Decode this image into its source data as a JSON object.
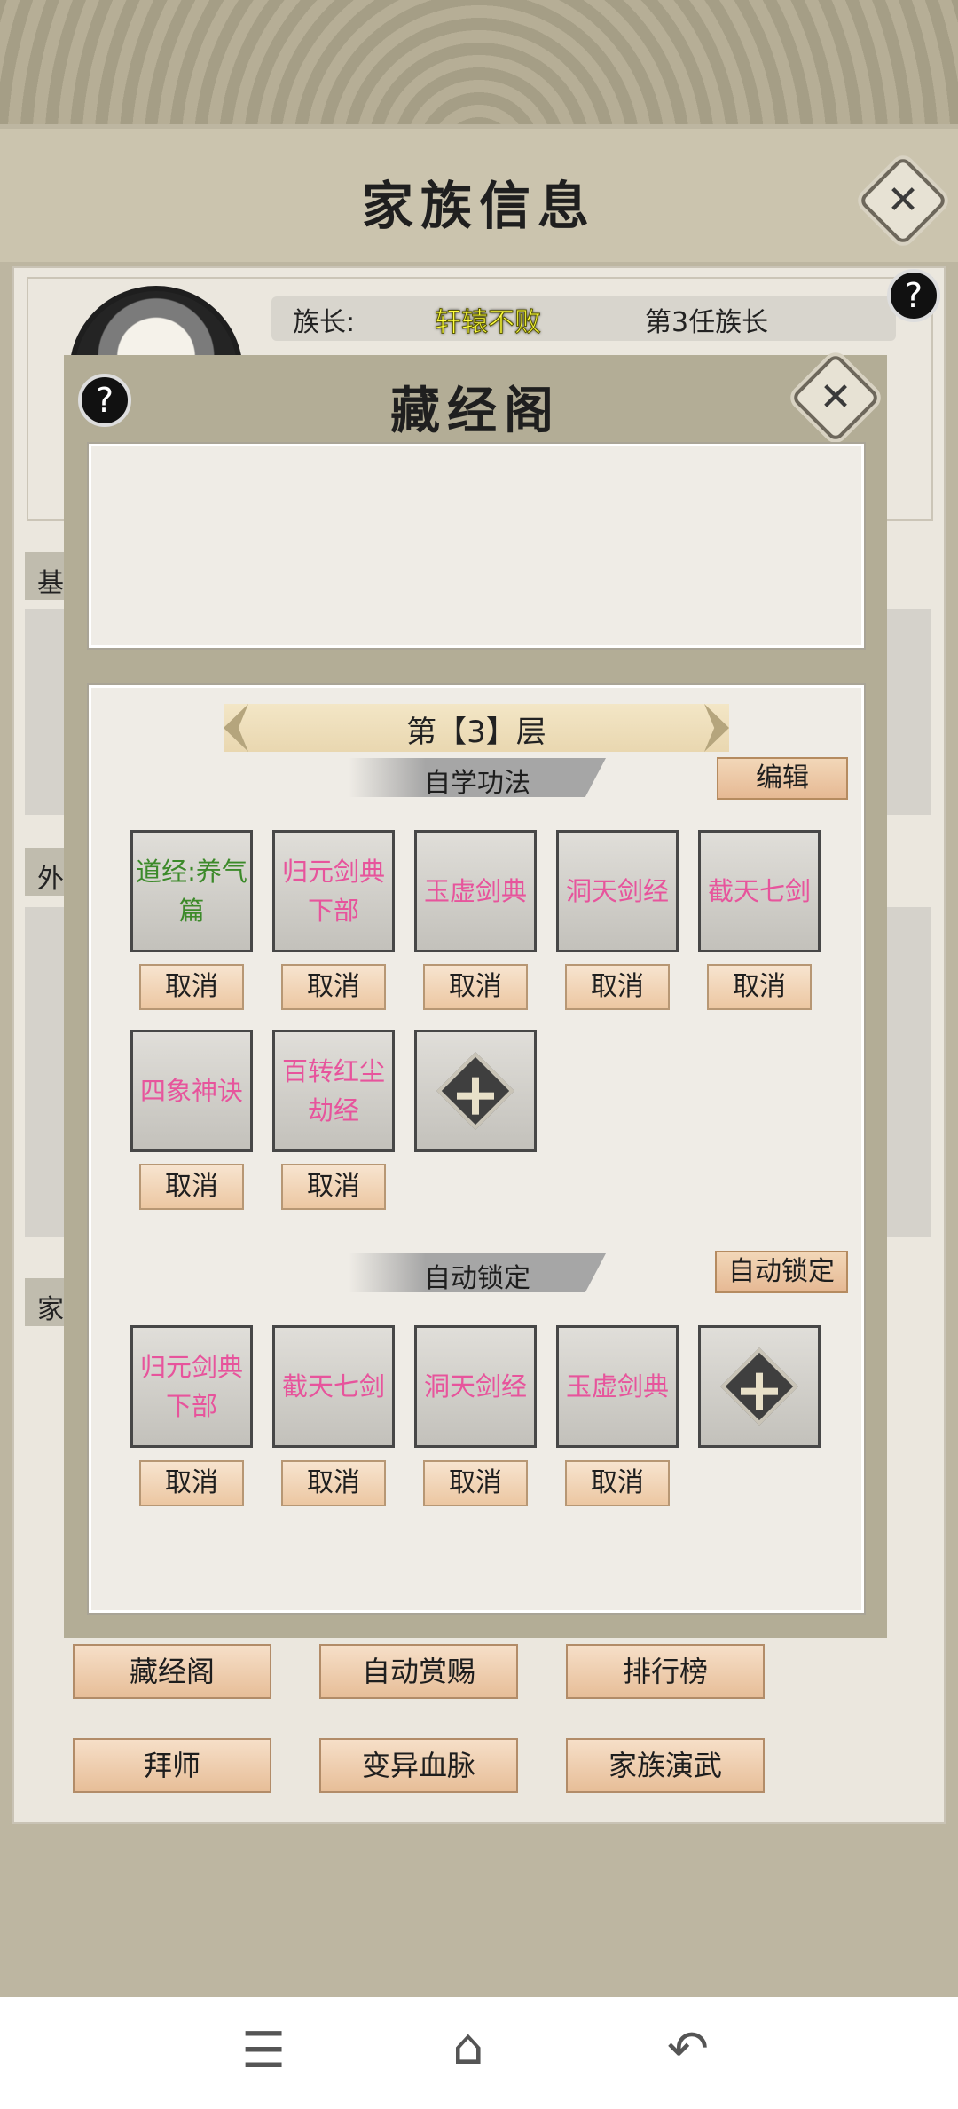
{
  "outer": {
    "title": "家族信息"
  },
  "leader": {
    "label": "族长:",
    "name": "轩辕不败",
    "rank": "第3任族长"
  },
  "side_tabs": [
    "基",
    "外",
    "家"
  ],
  "modal": {
    "title": "藏经阁",
    "floor": "第【3】层",
    "self_section": {
      "title": "自学功法",
      "edit_label": "编辑"
    },
    "self_skills": [
      {
        "name": "道经:养气篇",
        "cancel": "取消"
      },
      {
        "name": "归元剑典下部",
        "cancel": "取消"
      },
      {
        "name": "玉虚剑典",
        "cancel": "取消"
      },
      {
        "name": "洞天剑经",
        "cancel": "取消"
      },
      {
        "name": "截天七剑",
        "cancel": "取消"
      },
      {
        "name": "四象神诀",
        "cancel": "取消"
      },
      {
        "name": "百转红尘劫经",
        "cancel": "取消"
      }
    ],
    "auto_section": {
      "title": "自动锁定",
      "lock_label": "自动锁定"
    },
    "auto_skills": [
      {
        "name": "归元剑典下部",
        "cancel": "取消"
      },
      {
        "name": "截天七剑",
        "cancel": "取消"
      },
      {
        "name": "洞天剑经",
        "cancel": "取消"
      },
      {
        "name": "玉虚剑典",
        "cancel": "取消"
      }
    ]
  },
  "bottom_buttons": [
    "藏经阁",
    "自动赏赐",
    "排行榜",
    "拜师",
    "变异血脉",
    "家族演武"
  ],
  "colors": {
    "green_skill": "#3c8a2a",
    "pink_skill": "#e7549c",
    "leader_name": "#ffff40"
  },
  "icons": {
    "help": "?",
    "close": "✕",
    "nav_menu": "☰",
    "nav_home": "⌂",
    "nav_back": "↶"
  }
}
